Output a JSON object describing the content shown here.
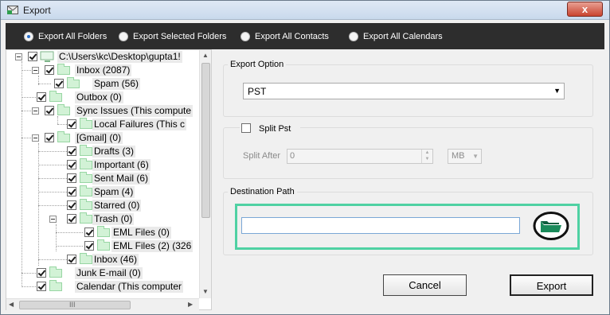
{
  "window": {
    "title": "Export",
    "close_glyph": "x"
  },
  "export_options": [
    {
      "label": "Export All Folders",
      "selected": true
    },
    {
      "label": "Export Selected Folders",
      "selected": false
    },
    {
      "label": "Export All Contacts",
      "selected": false
    },
    {
      "label": "Export All Calendars",
      "selected": false
    }
  ],
  "tree": {
    "root": "C:\\Users\\kc\\Desktop\\gupta1!",
    "items": [
      {
        "label": "Inbox (2087)",
        "checked": true
      },
      {
        "label": "Spam (56)",
        "checked": true
      },
      {
        "label": "Outbox (0)",
        "checked": true
      },
      {
        "label": "Sync Issues (This compute",
        "checked": true
      },
      {
        "label": "Local Failures (This c",
        "checked": true
      },
      {
        "label": "[Gmail] (0)",
        "checked": true
      },
      {
        "label": "Drafts (3)",
        "checked": true
      },
      {
        "label": "Important (6)",
        "checked": true
      },
      {
        "label": "Sent Mail (6)",
        "checked": true
      },
      {
        "label": "Spam (4)",
        "checked": true
      },
      {
        "label": "Starred (0)",
        "checked": true
      },
      {
        "label": "Trash (0)",
        "checked": true
      },
      {
        "label": "EML Files (0)",
        "checked": true
      },
      {
        "label": "EML Files (2) (326",
        "checked": true
      },
      {
        "label": "Inbox (46)",
        "checked": true
      },
      {
        "label": "Junk E-mail (0)",
        "checked": true
      },
      {
        "label": "Calendar (This computer",
        "checked": true
      }
    ],
    "hscroll_glyph": "III"
  },
  "export_option_group": {
    "title": "Export Option",
    "format_value": "PST"
  },
  "split_group": {
    "title": "Split Pst",
    "checked": false,
    "split_after_label": "Split After",
    "split_after_value": "0",
    "unit_value": "MB"
  },
  "destination_group": {
    "title": "Destination Path",
    "path_value": ""
  },
  "buttons": {
    "cancel": "Cancel",
    "export": "Export"
  },
  "colors": {
    "option_bar": "#2d2d2d",
    "destination_highlight": "#4fd1a3",
    "folder_icon": "#d2f2d6"
  }
}
